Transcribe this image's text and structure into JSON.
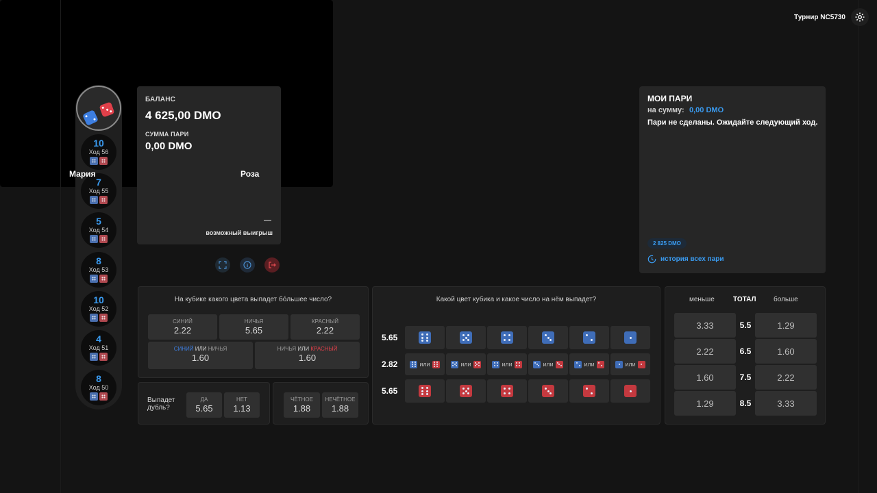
{
  "history": {
    "rounds": [
      {
        "total": "10",
        "move": "Ход 56"
      },
      {
        "total": "7",
        "move": "Ход 55"
      },
      {
        "total": "5",
        "move": "Ход 54"
      },
      {
        "total": "8",
        "move": "Ход 53"
      },
      {
        "total": "10",
        "move": "Ход 52"
      },
      {
        "total": "4",
        "move": "Ход 51"
      },
      {
        "total": "8",
        "move": "Ход 50"
      }
    ]
  },
  "balance": {
    "label": "БАЛАНС",
    "value": "4 625,00 DMO",
    "bet_label": "СУММА ПАРИ",
    "bet_value": "0,00 DMO",
    "win_value": "—",
    "win_label": "возможный выигрыш"
  },
  "video": {
    "tournament": "Турнир NC5730",
    "player_left": "Мария",
    "player_right": "Роза"
  },
  "my_bets": {
    "title": "МОИ ПАРИ",
    "sum_label": "на сумму:",
    "sum_value": "0,00 DMO",
    "message": "Пари не сделаны. Ожидайте следующий ход.",
    "badge": "2 825 DMO",
    "history_link": "история всех пари"
  },
  "color_bet": {
    "question": "На кубике какого цвета выпадет бóльшее число?",
    "blue_label": "СИНИЙ",
    "blue_odds": "2.22",
    "draw_label": "НИЧЬЯ",
    "draw_odds": "5.65",
    "red_label": "КРАСНЫЙ",
    "red_odds": "2.22",
    "or_word": "ИЛИ",
    "blue_or_draw_odds": "1.60",
    "draw_or_red_odds": "1.60"
  },
  "double_bet": {
    "question": "Выпадет дубль?",
    "yes_label": "ДА",
    "yes_odds": "5.65",
    "no_label": "НЕТ",
    "no_odds": "1.13"
  },
  "parity_bet": {
    "even_label": "ЧЁТНОЕ",
    "even_odds": "1.88",
    "odd_label": "НЕЧЁТНОЕ",
    "odd_odds": "1.88"
  },
  "number_bet": {
    "question": "Какой цвет кубика и какое число на нём выпадет?",
    "row1_odds": "5.65",
    "row2_odds": "2.82",
    "row3_odds": "5.65",
    "or_word": "или"
  },
  "total_bet": {
    "less_label": "меньше",
    "total_label": "ТОТАЛ",
    "more_label": "больше",
    "rows": [
      {
        "less": "3.33",
        "line": "5.5",
        "more": "1.29"
      },
      {
        "less": "2.22",
        "line": "6.5",
        "more": "1.60"
      },
      {
        "less": "1.60",
        "line": "7.5",
        "more": "2.22"
      },
      {
        "less": "1.29",
        "line": "8.5",
        "more": "3.33"
      }
    ]
  },
  "colors": {
    "accent_blue": "#3a9bf0",
    "die_blue": "#3f6db8",
    "die_red": "#c4393f",
    "panel": "#262626",
    "background": "#141414"
  }
}
